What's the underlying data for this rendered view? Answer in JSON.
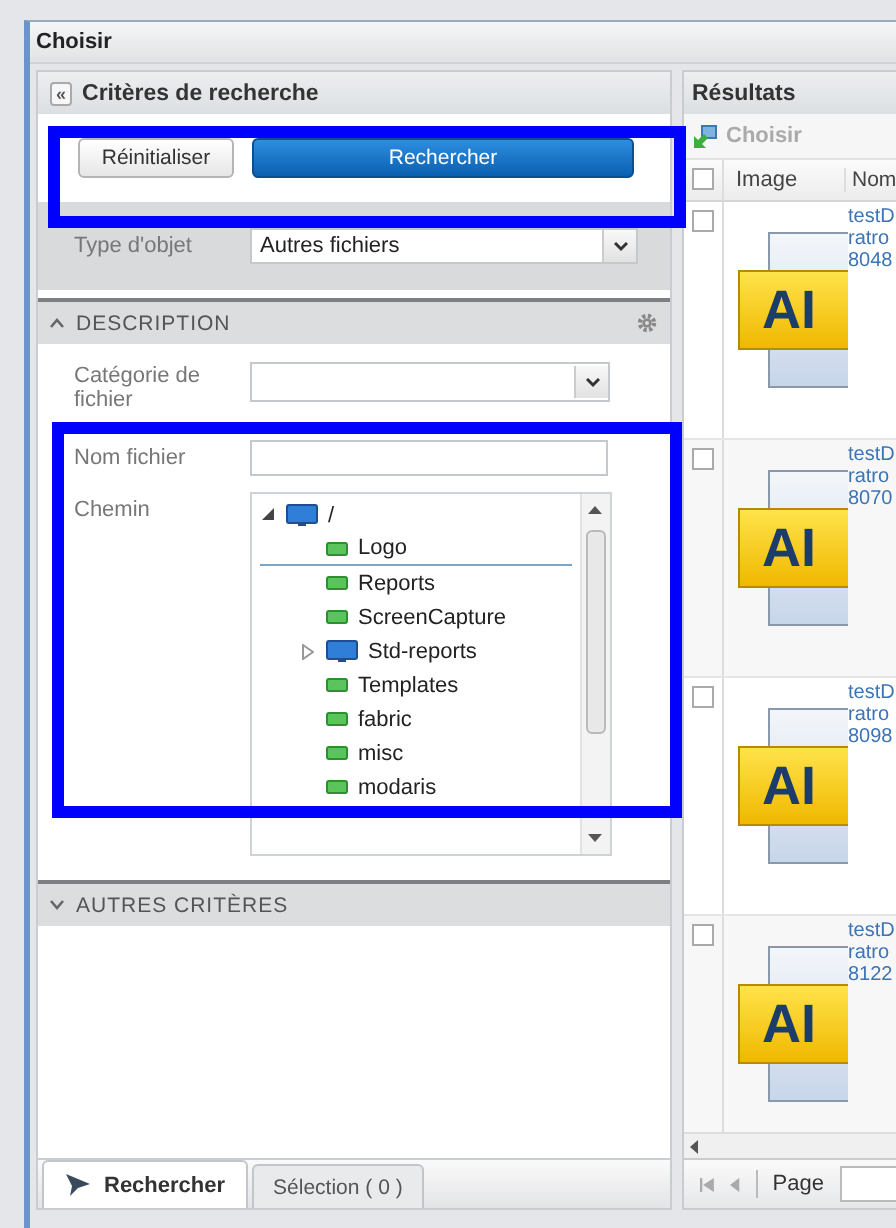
{
  "window": {
    "title": "Choisir"
  },
  "criteria": {
    "title": "Critères de recherche",
    "collapse_button": "«"
  },
  "toolbar": {
    "highlighted": true,
    "buttons": [
      {
        "label": "Réinitialiser",
        "kind": "plain"
      },
      {
        "label": "Rechercher",
        "kind": "primary"
      }
    ]
  },
  "object_type": {
    "label": "Type d'objet",
    "value": "Autres fichiers"
  },
  "description": {
    "title": "DESCRIPTION",
    "expanded": true
  },
  "category": {
    "label": "Catégorie de fichier"
  },
  "path_group": {
    "highlighted": true,
    "file_name": {
      "label": "Nom fichier"
    },
    "path": {
      "label": "Chemin",
      "tree": [
        {
          "label": "/",
          "kind": "drive",
          "expanded": true,
          "selected": false,
          "children": [
            {
              "label": "Logo",
              "kind": "folder",
              "selected": true
            },
            {
              "label": "Reports",
              "kind": "folder",
              "selected": false
            },
            {
              "label": "ScreenCapture",
              "kind": "folder",
              "selected": false
            },
            {
              "label": "Std-reports",
              "kind": "drive",
              "expanded": false,
              "selected": false
            },
            {
              "label": "Templates",
              "kind": "folder",
              "selected": false
            },
            {
              "label": "fabric",
              "kind": "folder",
              "selected": false
            },
            {
              "label": "misc",
              "kind": "folder",
              "selected": false
            },
            {
              "label": "modaris",
              "kind": "folder",
              "selected": false
            }
          ]
        }
      ]
    }
  },
  "other_criteria": {
    "title": "AUTRES CRITÈRES",
    "expanded": false
  },
  "bottom_tabs": [
    {
      "label": "Rechercher",
      "selected": true
    },
    {
      "label": "Sélection ( 0 )",
      "selected": false
    }
  ],
  "results": {
    "title": "Résultats",
    "toolbar_button": "Choisir",
    "all_checked": false,
    "columns": [
      "Image",
      "Nom"
    ],
    "rows": [
      {
        "checked": false,
        "thumb": "AI",
        "lines": [
          "testD",
          "ratro",
          "8048"
        ]
      },
      {
        "checked": false,
        "thumb": "AI",
        "lines": [
          "testD",
          "ratro",
          "8070"
        ]
      },
      {
        "checked": false,
        "thumb": "AI",
        "lines": [
          "testD",
          "ratro",
          "8098"
        ]
      },
      {
        "checked": false,
        "thumb": "AI",
        "lines": [
          "testD",
          "ratro",
          "8122"
        ]
      }
    ],
    "pager": {
      "label": "Page"
    }
  }
}
